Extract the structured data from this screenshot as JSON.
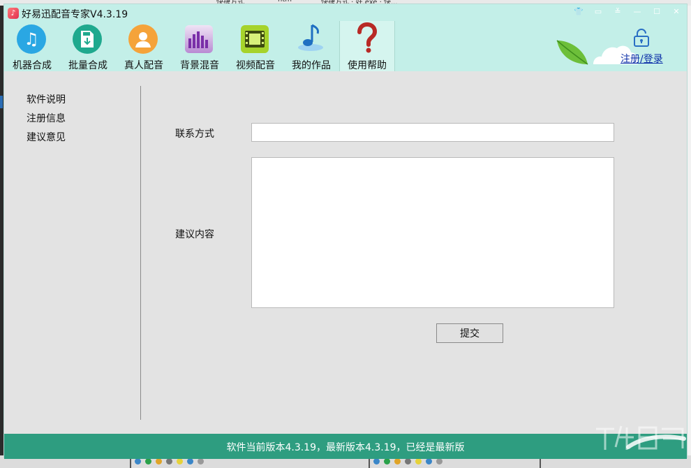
{
  "app": {
    "title": "好易迅配音专家V4.3.19",
    "icon": "music-note-app-icon"
  },
  "window_controls": [
    "shirt-skin-icon",
    "message-icon",
    "menu-dropdown-icon",
    "minimize-icon",
    "maximize-icon",
    "close-icon"
  ],
  "toolbar": {
    "items": [
      {
        "label": "机器合成",
        "icon": "music-note-icon",
        "color": "#2aa7e3"
      },
      {
        "label": "批量合成",
        "icon": "mp3-file-icon",
        "color": "#1fa98e"
      },
      {
        "label": "真人配音",
        "icon": "person-icon",
        "color": "#f5a33a"
      },
      {
        "label": "背景混音",
        "icon": "equalizer-icon",
        "color": "#a45ad0"
      },
      {
        "label": "视频配音",
        "icon": "film-icon",
        "color": "#a6d32b"
      },
      {
        "label": "我的作品",
        "icon": "music-note-blue-icon",
        "color": "#3b8fd6"
      },
      {
        "label": "使用帮助",
        "icon": "question-mark-icon",
        "color": "#c0302c"
      }
    ],
    "active_index": 6
  },
  "account": {
    "login_label": "注册/登录"
  },
  "sidebar": {
    "items": [
      {
        "label": "软件说明"
      },
      {
        "label": "注册信息"
      },
      {
        "label": "建议意见"
      }
    ]
  },
  "form": {
    "contact_label": "联系方式",
    "contact_value": "",
    "content_label": "建议内容",
    "content_value": "",
    "submit_label": "提交"
  },
  "status": {
    "text": "软件当前版本4.3.19，最新版本4.3.19，已经是最新版"
  },
  "colors": {
    "header_bg": "#c3efe8",
    "status_bg": "#2e9d80",
    "link": "#0b2fa8"
  }
}
